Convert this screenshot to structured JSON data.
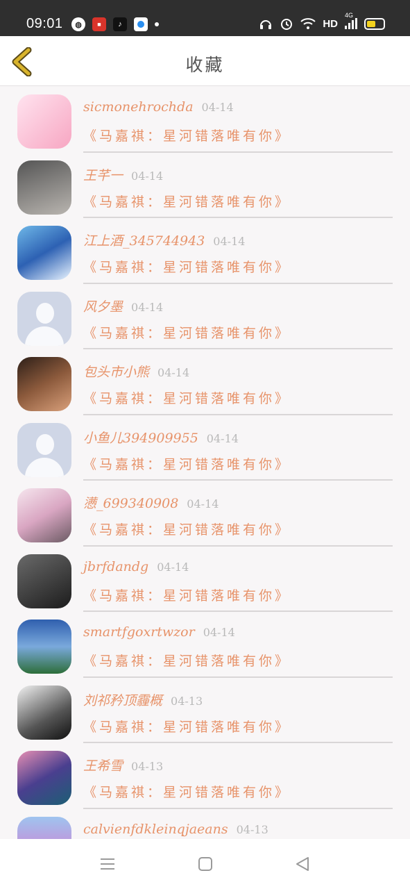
{
  "status_bar": {
    "time": "09:01",
    "network": "HD",
    "cellular": "4G",
    "battery_color": "#f3d21e",
    "icons": [
      "globe-icon",
      "red-app-icon",
      "tiktok-icon",
      "blue-app-icon",
      "headphones-icon",
      "alarm-icon",
      "wifi-icon",
      "signal-icon",
      "battery-icon"
    ]
  },
  "header": {
    "title": "收藏",
    "back_color": "#d9b42c"
  },
  "favorites": [
    {
      "name": "sicmonehrochda",
      "date": "04-14",
      "title": "《马嘉祺：星河错落唯有你》",
      "avatar": "linear-gradient(135deg,#ffe3ef,#f7a6c2)"
    },
    {
      "name": "王芊一",
      "date": "04-14",
      "title": "《马嘉祺：星河错落唯有你》",
      "avatar": "linear-gradient(160deg,#555,#b9b5b0)"
    },
    {
      "name": "江上酒_345744943",
      "date": "04-14",
      "title": "《马嘉祺：星河错落唯有你》",
      "avatar": "linear-gradient(150deg,#6fb8e8,#2d61b3 50%,#e9f4ff)"
    },
    {
      "name": "风夕墨",
      "date": "04-14",
      "title": "《马嘉祺：星河错落唯有你》",
      "avatar": "#cfd6e6"
    },
    {
      "name": "包头市小熊",
      "date": "04-14",
      "title": "《马嘉祺：星河错落唯有你》",
      "avatar": "linear-gradient(150deg,#2d1f18,#8c5a3c,#d9a07b)"
    },
    {
      "name": "小鱼儿394909955",
      "date": "04-14",
      "title": "《马嘉祺：星河错落唯有你》",
      "avatar": "#cfd6e6"
    },
    {
      "name": "懑_699340908",
      "date": "04-14",
      "title": "《马嘉祺：星河错落唯有你》",
      "avatar": "linear-gradient(150deg,#f6e6ee,#d9a6c2,#6b5a63)"
    },
    {
      "name": "jbrfdandg",
      "date": "04-14",
      "title": "《马嘉祺：星河错落唯有你》",
      "avatar": "linear-gradient(150deg,#6a6a6a,#1c1c1c)"
    },
    {
      "name": "smartfgoxrtwzor",
      "date": "04-14",
      "title": "《马嘉祺：星河错落唯有你》",
      "avatar": "linear-gradient(180deg,#2f5fae,#7aa9dc 50%,#2d6e3a)"
    },
    {
      "name": "刘祁矜顶霾概",
      "date": "04-13",
      "title": "《马嘉祺：星河错落唯有你》",
      "avatar": "linear-gradient(150deg,#f2f2f2,#555 60%,#111)"
    },
    {
      "name": "王希雪",
      "date": "04-13",
      "title": "《马嘉祺：星河错落唯有你》",
      "avatar": "linear-gradient(150deg,#e78fb3,#4a3f8f 50%,#1c5f74)"
    },
    {
      "name": "calvienfdkleinqjaeans",
      "date": "04-13",
      "title": "",
      "avatar": "linear-gradient(180deg,#9fc4ef,#c58ed8 60%,#6b3c9f)"
    }
  ],
  "nav_bar": {
    "buttons": [
      "menu-icon",
      "home-icon",
      "back-triangle-icon"
    ]
  }
}
